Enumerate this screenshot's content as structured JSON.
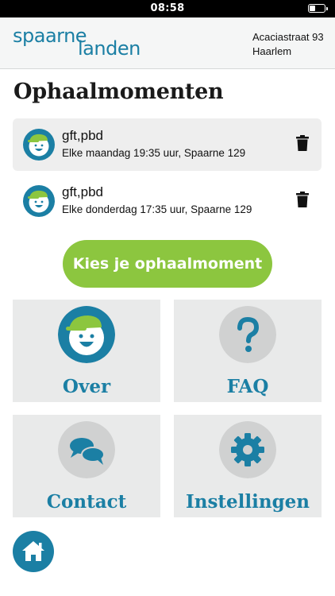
{
  "status_bar": {
    "time": "08:58"
  },
  "header": {
    "logo_line1": "spaarne",
    "logo_line2": "landen",
    "address_line1": "Acaciastraat 93",
    "address_line2": "Haarlem"
  },
  "page_title": "Ophaalmomenten",
  "pickups": [
    {
      "type": "gft,pbd",
      "when": "Elke maandag 19:35 uur, Spaarne 129"
    },
    {
      "type": "gft,pbd",
      "when": "Elke donderdag 17:35 uur, Spaarne 129"
    }
  ],
  "cta_label": "Kies je ophaalmoment",
  "tiles": [
    {
      "label": "Over",
      "icon": "mascot-icon"
    },
    {
      "label": "FAQ",
      "icon": "question-icon"
    },
    {
      "label": "Contact",
      "icon": "chat-icon"
    },
    {
      "label": "Instellingen",
      "icon": "gear-icon"
    }
  ],
  "colors": {
    "brand_blue": "#1b7fa4",
    "cta_green": "#8cc63f",
    "tile_bg": "#e9eaea"
  }
}
